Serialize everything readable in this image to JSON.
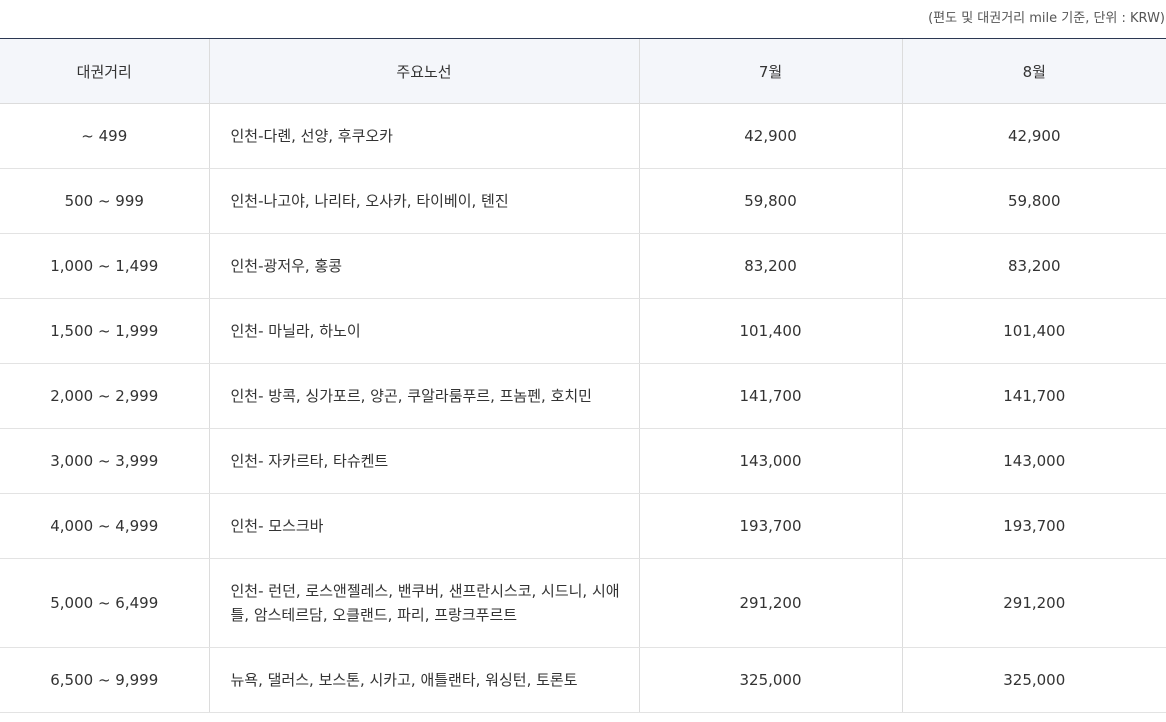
{
  "note": "(편도 및 대권거리 mile 기준, 단위 : KRW)",
  "headers": {
    "distance": "대권거리",
    "routes": "주요노선",
    "july": "7월",
    "august": "8월"
  },
  "rows": [
    {
      "distance": "~ 499",
      "routes": "인천-다롄, 선양, 후쿠오카",
      "july": "42,900",
      "august": "42,900"
    },
    {
      "distance": "500 ~ 999",
      "routes": "인천-나고야, 나리타, 오사카, 타이베이, 톈진",
      "july": "59,800",
      "august": "59,800"
    },
    {
      "distance": "1,000 ~ 1,499",
      "routes": "인천-광저우, 홍콩",
      "july": "83,200",
      "august": "83,200"
    },
    {
      "distance": "1,500 ~ 1,999",
      "routes": "인천- 마닐라, 하노이",
      "july": "101,400",
      "august": "101,400"
    },
    {
      "distance": "2,000 ~ 2,999",
      "routes": "인천- 방콕, 싱가포르, 양곤, 쿠알라룸푸르, 프놈펜, 호치민",
      "july": "141,700",
      "august": "141,700"
    },
    {
      "distance": "3,000 ~ 3,999",
      "routes": "인천- 자카르타, 타슈켄트",
      "july": "143,000",
      "august": "143,000"
    },
    {
      "distance": "4,000 ~ 4,999",
      "routes": "인천- 모스크바",
      "july": "193,700",
      "august": "193,700"
    },
    {
      "distance": "5,000 ~ 6,499",
      "routes": "인천- 런던, 로스앤젤레스, 밴쿠버, 샌프란시스코, 시드니, 시애틀, 암스테르담, 오클랜드, 파리, 프랑크푸르트",
      "july": "291,200",
      "august": "291,200"
    },
    {
      "distance": "6,500 ~ 9,999",
      "routes": "뉴욕, 댈러스, 보스톤, 시카고, 애틀랜타, 워싱턴, 토론토",
      "july": "325,000",
      "august": "325,000"
    }
  ]
}
